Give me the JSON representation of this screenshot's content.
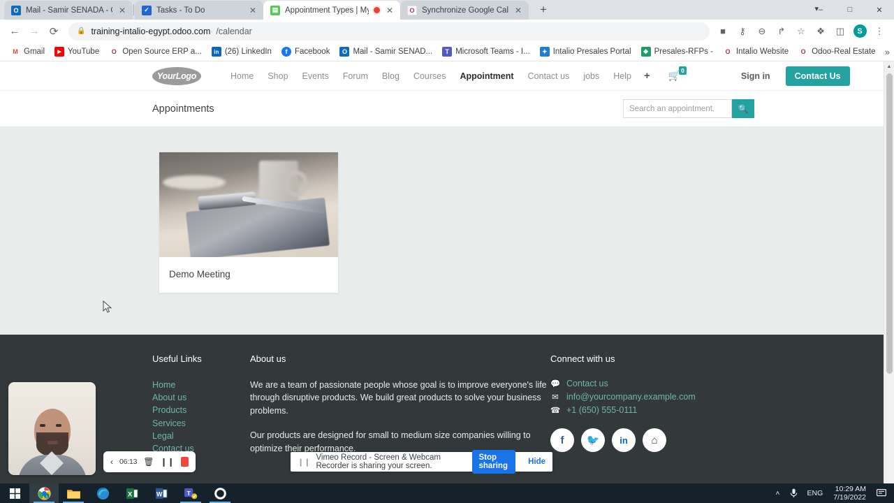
{
  "browser": {
    "tabs": [
      {
        "title": "Mail - Samir SENADA - Outlook",
        "favicon": "outlook-icon",
        "favicon_color": "#0f6cbd",
        "favicon_glyph": "O",
        "active": false,
        "recording": false
      },
      {
        "title": "Tasks - To Do",
        "favicon": "todo-icon",
        "favicon_color": "#2564cf",
        "favicon_glyph": "✓",
        "active": false,
        "recording": false
      },
      {
        "title": "Appointment Types | My We",
        "favicon": "odoo-icon",
        "favicon_color": "#5ac65a",
        "favicon_glyph": "▤",
        "active": true,
        "recording": true
      },
      {
        "title": "Synchronize Google Calendar wit",
        "favicon": "odoo-circle-icon",
        "favicon_color": "#a0336b",
        "favicon_glyph": "O",
        "active": false,
        "recording": false
      }
    ],
    "new_tab_label": "+",
    "tab_search_icon": "chevron-down-icon",
    "window_controls": {
      "minimize": "–",
      "maximize": "□",
      "close": "✕"
    },
    "nav": {
      "back": "←",
      "forward": "→",
      "reload": "⟳"
    },
    "omnibox": {
      "lock_icon": "lock-icon",
      "url_main": "training-intalio-egypt.odoo.com",
      "url_path": "/calendar"
    },
    "toolbar_icons": [
      {
        "name": "video-record-icon",
        "glyph": "■"
      },
      {
        "name": "key-password-icon",
        "glyph": "⚷"
      },
      {
        "name": "zoom-out-icon",
        "glyph": "⊖"
      },
      {
        "name": "share-icon",
        "glyph": "↱"
      },
      {
        "name": "bookmark-star-icon",
        "glyph": "☆"
      },
      {
        "name": "extensions-puzzle-icon",
        "glyph": "❖"
      },
      {
        "name": "sidepanel-icon",
        "glyph": "◫"
      }
    ],
    "profile_initial": "S",
    "menu_icon": "three-dot-menu-icon",
    "bookmarks": [
      {
        "label": "Gmail",
        "color": "#ffffff",
        "glyph": "M",
        "glyph_color": "#ea4335"
      },
      {
        "label": "YouTube",
        "color": "#ff0000",
        "glyph": "▶"
      },
      {
        "label": "Open Source ERP a...",
        "color": "#ffffff",
        "glyph": "O",
        "glyph_color": "#a0336b"
      },
      {
        "label": "(26) LinkedIn",
        "color": "#0a66c2",
        "glyph": "in"
      },
      {
        "label": "Facebook",
        "color": "#1877f2",
        "glyph": "f"
      },
      {
        "label": "Mail - Samir SENAD...",
        "color": "#0f6cbd",
        "glyph": "O"
      },
      {
        "label": "Microsoft Teams - I...",
        "color": "#5059c9",
        "glyph": "T"
      },
      {
        "label": "Intalio Presales Portal",
        "color": "#1c7ed6",
        "glyph": "✦"
      },
      {
        "label": "Presales-RFPs -",
        "color": "#1a9e6c",
        "glyph": "❖"
      },
      {
        "label": "Intalio Website",
        "color": "#ffffff",
        "glyph": "O",
        "glyph_color": "#a0336b"
      },
      {
        "label": "Odoo-Real Estate",
        "color": "#ffffff",
        "glyph": "O",
        "glyph_color": "#a0336b"
      }
    ],
    "bookmarks_overflow": "»"
  },
  "site": {
    "logo_text": "YourLogo",
    "nav_links": [
      {
        "label": "Home",
        "active": false
      },
      {
        "label": "Shop",
        "active": false
      },
      {
        "label": "Events",
        "active": false
      },
      {
        "label": "Forum",
        "active": false
      },
      {
        "label": "Blog",
        "active": false
      },
      {
        "label": "Courses",
        "active": false
      },
      {
        "label": "Appointment",
        "active": true
      },
      {
        "label": "Contact us",
        "active": false
      },
      {
        "label": "jobs",
        "active": false
      },
      {
        "label": "Help",
        "active": false
      }
    ],
    "nav_plus": "+",
    "cart_icon": "shopping-cart-icon",
    "cart_count": "0",
    "sign_in_label": "Sign in",
    "contact_button_label": "Contact Us",
    "accent_color": "#23a39f"
  },
  "page": {
    "title": "Appointments",
    "search_placeholder": "Search an appointment.",
    "search_value": "",
    "search_icon": "search-icon",
    "cards": [
      {
        "title": "Demo Meeting",
        "image": "desk-notebook-pen-photo"
      }
    ]
  },
  "footer": {
    "useful_links": {
      "heading": "Useful Links",
      "items": [
        "Home",
        "About us",
        "Products",
        "Services",
        "Legal",
        "Contact us"
      ]
    },
    "about": {
      "heading": "About us",
      "paragraphs": [
        "We are a team of passionate people whose goal is to improve everyone's life through disruptive products. We build great products to solve your business problems.",
        "Our products are designed for small to medium size companies willing to optimize their performance."
      ]
    },
    "connect": {
      "heading": "Connect with us",
      "rows": [
        {
          "icon": "chat-bubble-icon",
          "glyph": "💬",
          "text": "Contact us"
        },
        {
          "icon": "envelope-icon",
          "glyph": "✉",
          "text": "info@yourcompany.example.com"
        },
        {
          "icon": "phone-icon",
          "glyph": "☎",
          "text": "+1 (650) 555-0111"
        }
      ],
      "socials": [
        {
          "name": "facebook-icon",
          "glyph": "f",
          "color": "#3b5998"
        },
        {
          "name": "twitter-icon",
          "glyph": "🐦",
          "color": "#1da1f2"
        },
        {
          "name": "linkedin-icon",
          "glyph": "in",
          "color": "#0a66c2"
        },
        {
          "name": "home-icon",
          "glyph": "⌂",
          "color": "#33393b"
        }
      ]
    }
  },
  "recorder": {
    "collapse_icon": "chevron-left-icon",
    "time": "06:13",
    "delete_icon": "trash-icon",
    "pause_icon": "pause-icon",
    "stop_icon": "stop-record-icon"
  },
  "share_notification": {
    "pause_icon": "pause-icon",
    "message": "Vimeo Record - Screen & Webcam Recorder is sharing your screen.",
    "stop_label": "Stop sharing",
    "hide_label": "Hide",
    "stop_color": "#1a73e8"
  },
  "taskbar": {
    "start_icon": "windows-start-icon",
    "apps": [
      {
        "name": "chrome-icon",
        "glyph": "●",
        "open": true,
        "selected": true
      },
      {
        "name": "file-explorer-icon",
        "glyph": "📁",
        "open": true,
        "selected": false
      },
      {
        "name": "edge-icon",
        "glyph": "◐",
        "open": false,
        "selected": false
      },
      {
        "name": "excel-icon",
        "glyph": "X",
        "open": false,
        "selected": false
      },
      {
        "name": "word-icon",
        "glyph": "W",
        "open": false,
        "selected": false
      },
      {
        "name": "teams-icon",
        "glyph": "T",
        "open": true,
        "selected": false
      },
      {
        "name": "settings-gear-icon",
        "glyph": "⚙",
        "open": true,
        "selected": false
      }
    ],
    "tray": {
      "chevron_up": "˄",
      "mic_icon": "microphone-icon",
      "language": "ENG",
      "time": "10:29 AM",
      "date": "7/19/2022",
      "notification_icon": "notification-icon"
    }
  }
}
